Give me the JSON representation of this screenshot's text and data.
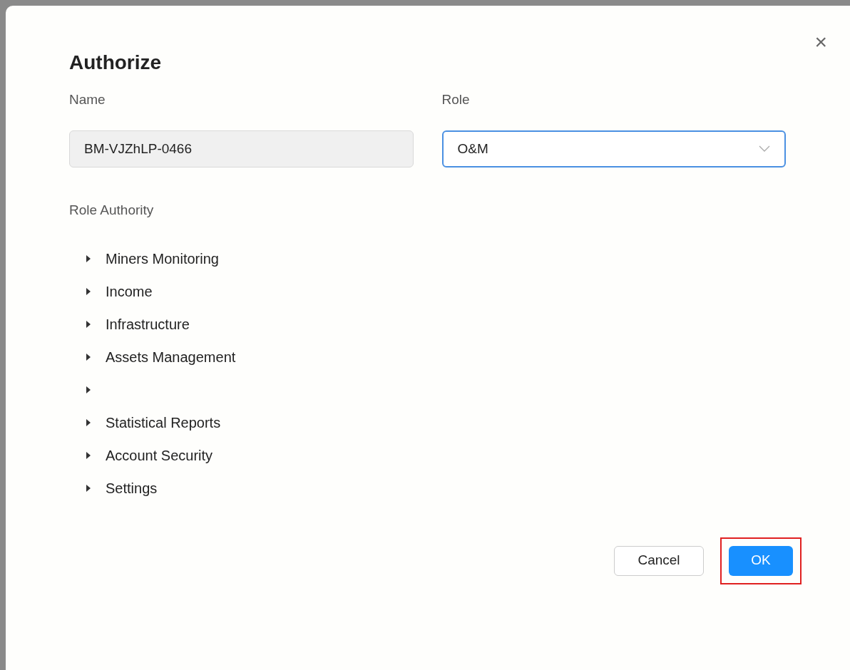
{
  "dialog": {
    "title": "Authorize",
    "close": "×"
  },
  "fields": [
    {
      "kind": "text",
      "label": "Name",
      "value": "BM-VJZhLP-0466",
      "disabled": true
    },
    {
      "kind": "select",
      "label": "Role",
      "value": "O&M",
      "focused": true
    }
  ],
  "section_label": "Role Authority",
  "tree": [
    {
      "label": "Miners Monitoring",
      "expanded": false
    },
    {
      "label": "Income",
      "expanded": false
    },
    {
      "label": "Infrastructure",
      "expanded": false
    },
    {
      "label": "Assets Management",
      "expanded": false
    },
    {
      "expanded": false
    },
    {
      "label": "Statistical Reports",
      "expanded": false
    },
    {
      "label": "Account Security",
      "expanded": false
    },
    {
      "label": "Settings",
      "expanded": false
    }
  ],
  "buttons": [
    {
      "label": "Cancel",
      "kind": "default"
    },
    {
      "label": "OK",
      "kind": "primary",
      "highlighted": true
    }
  ]
}
